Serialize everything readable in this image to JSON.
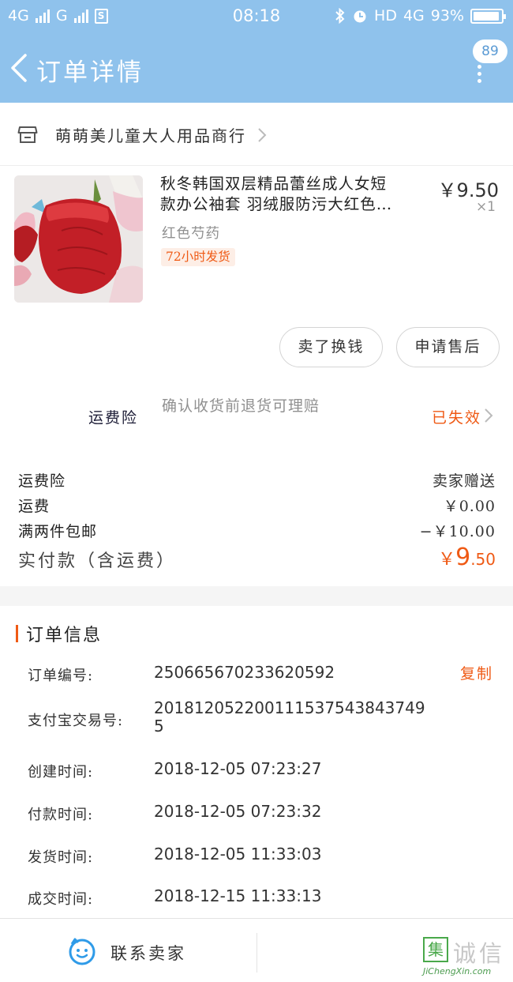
{
  "status_bar": {
    "network1": "4G",
    "network2": "G",
    "sim_badge": "S",
    "time": "08:18",
    "hd": "HD",
    "network3": "4G",
    "battery": "93%"
  },
  "nav": {
    "title": "订单详情",
    "message_count": "89"
  },
  "shop": {
    "name": "萌萌美儿童大人用品商行"
  },
  "product": {
    "title_line1": "秋冬韩国双层精品蕾丝成人女短",
    "title_line2": "款办公袖套 羽绒服防污大红色…",
    "sku": "红色芍药",
    "tag": "72小时发货",
    "price": "￥9.50",
    "qty": "×1"
  },
  "actions": {
    "sell": "卖了换钱",
    "service": "申请售后"
  },
  "insurance": {
    "label": "运费险",
    "desc": "确认收货前退货可理赔",
    "status": "已失效"
  },
  "fees": [
    {
      "label": "运费险",
      "value": "卖家赠送"
    },
    {
      "label": "运费",
      "value": "￥0.00"
    },
    {
      "label": "满两件包邮",
      "value": "−￥10.00"
    }
  ],
  "paid": {
    "label": "实付款（含运费）",
    "currency": "￥",
    "integer": "9",
    "decimal": ".50"
  },
  "order_info": {
    "title": "订单信息",
    "copy": "复制",
    "rows": [
      {
        "label": "订单编号:",
        "value": "250665670233620592"
      },
      {
        "label": "支付宝交易号:",
        "value": "2018120522001115375438437495"
      },
      {
        "label": "创建时间:",
        "value": "2018-12-05 07:23:27"
      },
      {
        "label": "付款时间:",
        "value": "2018-12-05 07:23:32"
      },
      {
        "label": "发货时间:",
        "value": "2018-12-05 11:33:03"
      },
      {
        "label": "成交时间:",
        "value": "2018-12-15 11:33:13"
      }
    ]
  },
  "bottom": {
    "contact": "联系卖家"
  },
  "watermark": {
    "mark": "集",
    "text": "诚信",
    "url": "JiChengXin.com"
  },
  "colors": {
    "accent": "#ef5a15",
    "header": "#8fc2ec"
  }
}
